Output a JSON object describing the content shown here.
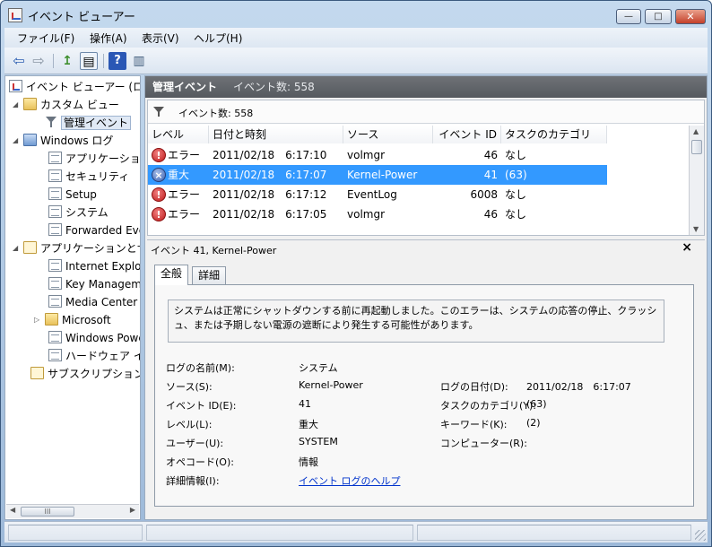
{
  "window": {
    "title": "イベント ビューアー",
    "controls": {
      "minimize": "—",
      "maximize": "□",
      "close": "✕"
    }
  },
  "menu": [
    "ファイル(F)",
    "操作(A)",
    "表示(V)",
    "ヘルプ(H)"
  ],
  "toolbar": {
    "back": "⇦",
    "forward": "⇨",
    "up": "↥",
    "panel": "▤",
    "help": "?",
    "action": "▥"
  },
  "tree": {
    "root": "イベント ビューアー (ローカル)",
    "custom_views": "カスタム ビュー",
    "admin_events": "管理イベント",
    "windows_logs": "Windows ログ",
    "windows_logs_items": [
      "アプリケーション",
      "セキュリティ",
      "Setup",
      "システム",
      "Forwarded Events"
    ],
    "apps_services": "アプリケーションとサービス ログ",
    "apps_items": [
      "Internet Explorer",
      "Key Management Service",
      "Media Center",
      "Microsoft",
      "Windows PowerShell",
      "ハードウェア イベント"
    ],
    "subscriptions": "サブスクリプション"
  },
  "main": {
    "header_title": "管理イベント",
    "header_count": "イベント数: 558",
    "filter_text": "イベント数: 558",
    "columns": [
      "レベル",
      "日付と時刻",
      "ソース",
      "イベント ID",
      "タスクのカテゴリ"
    ],
    "rows": [
      {
        "level": "エラー",
        "icon": "!",
        "datetime": "2011/02/18　6:17:10",
        "source": "volmgr",
        "id": "46",
        "category": "なし"
      },
      {
        "level": "重大",
        "icon": "×",
        "datetime": "2011/02/18　6:17:07",
        "source": "Kernel-Power",
        "id": "41",
        "category": "(63)"
      },
      {
        "level": "エラー",
        "icon": "!",
        "datetime": "2011/02/18　6:17:12",
        "source": "EventLog",
        "id": "6008",
        "category": "なし"
      },
      {
        "level": "エラー",
        "icon": "!",
        "datetime": "2011/02/18　6:17:05",
        "source": "volmgr",
        "id": "46",
        "category": "なし"
      }
    ]
  },
  "detail": {
    "title": "イベント 41, Kernel-Power",
    "close": "×",
    "tabs": [
      "全般",
      "詳細"
    ],
    "description": "システムは正常にシャットダウンする前に再起動しました。このエラーは、システムの応答の停止、クラッシュ、または予期しない電源の遮断により発生する可能性があります。",
    "labels": {
      "log_name": "ログの名前(M):",
      "source": "ソース(S):",
      "event_id": "イベント ID(E):",
      "level": "レベル(L):",
      "user": "ユーザー(U):",
      "opcode": "オペコード(O):",
      "more_info": "詳細情報(I):",
      "logged": "ログの日付(D):",
      "task_category": "タスクのカテゴリ(Y):",
      "keywords": "キーワード(K):",
      "computer": "コンピューター(R):"
    },
    "values": {
      "log_name": "システム",
      "source": "Kernel-Power",
      "event_id": "41",
      "level": "重大",
      "user": "SYSTEM",
      "opcode": "情報",
      "more_info_link": "イベント ログのヘルプ",
      "logged": "2011/02/18　6:17:07",
      "task_category": "(63)",
      "keywords": "(2)",
      "computer": ""
    }
  },
  "tree_scroll_glyph": "III",
  "colors": {
    "selection": "#3399ff",
    "header": "#5f6368",
    "link": "#0033cc"
  }
}
